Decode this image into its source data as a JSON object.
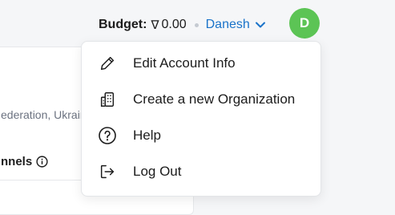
{
  "header": {
    "budget_label": "Budget:",
    "budget_currency_icon": "nabla-currency-icon",
    "budget_currency_glyph": "∇",
    "budget_value": "0.00",
    "user_name": "Danesh",
    "avatar_initial": "D",
    "avatar_color": "#5cc455",
    "link_color": "#1a73c9"
  },
  "background": {
    "location_text": "ederation, Ukraine",
    "section_title": "nnels"
  },
  "menu": {
    "items": [
      {
        "label": "Edit Account Info",
        "icon": "pencil-icon"
      },
      {
        "label": "Create a new Organization",
        "icon": "building-icon"
      },
      {
        "label": "Help",
        "icon": "question-circle-icon"
      },
      {
        "label": "Log Out",
        "icon": "logout-icon"
      }
    ]
  }
}
